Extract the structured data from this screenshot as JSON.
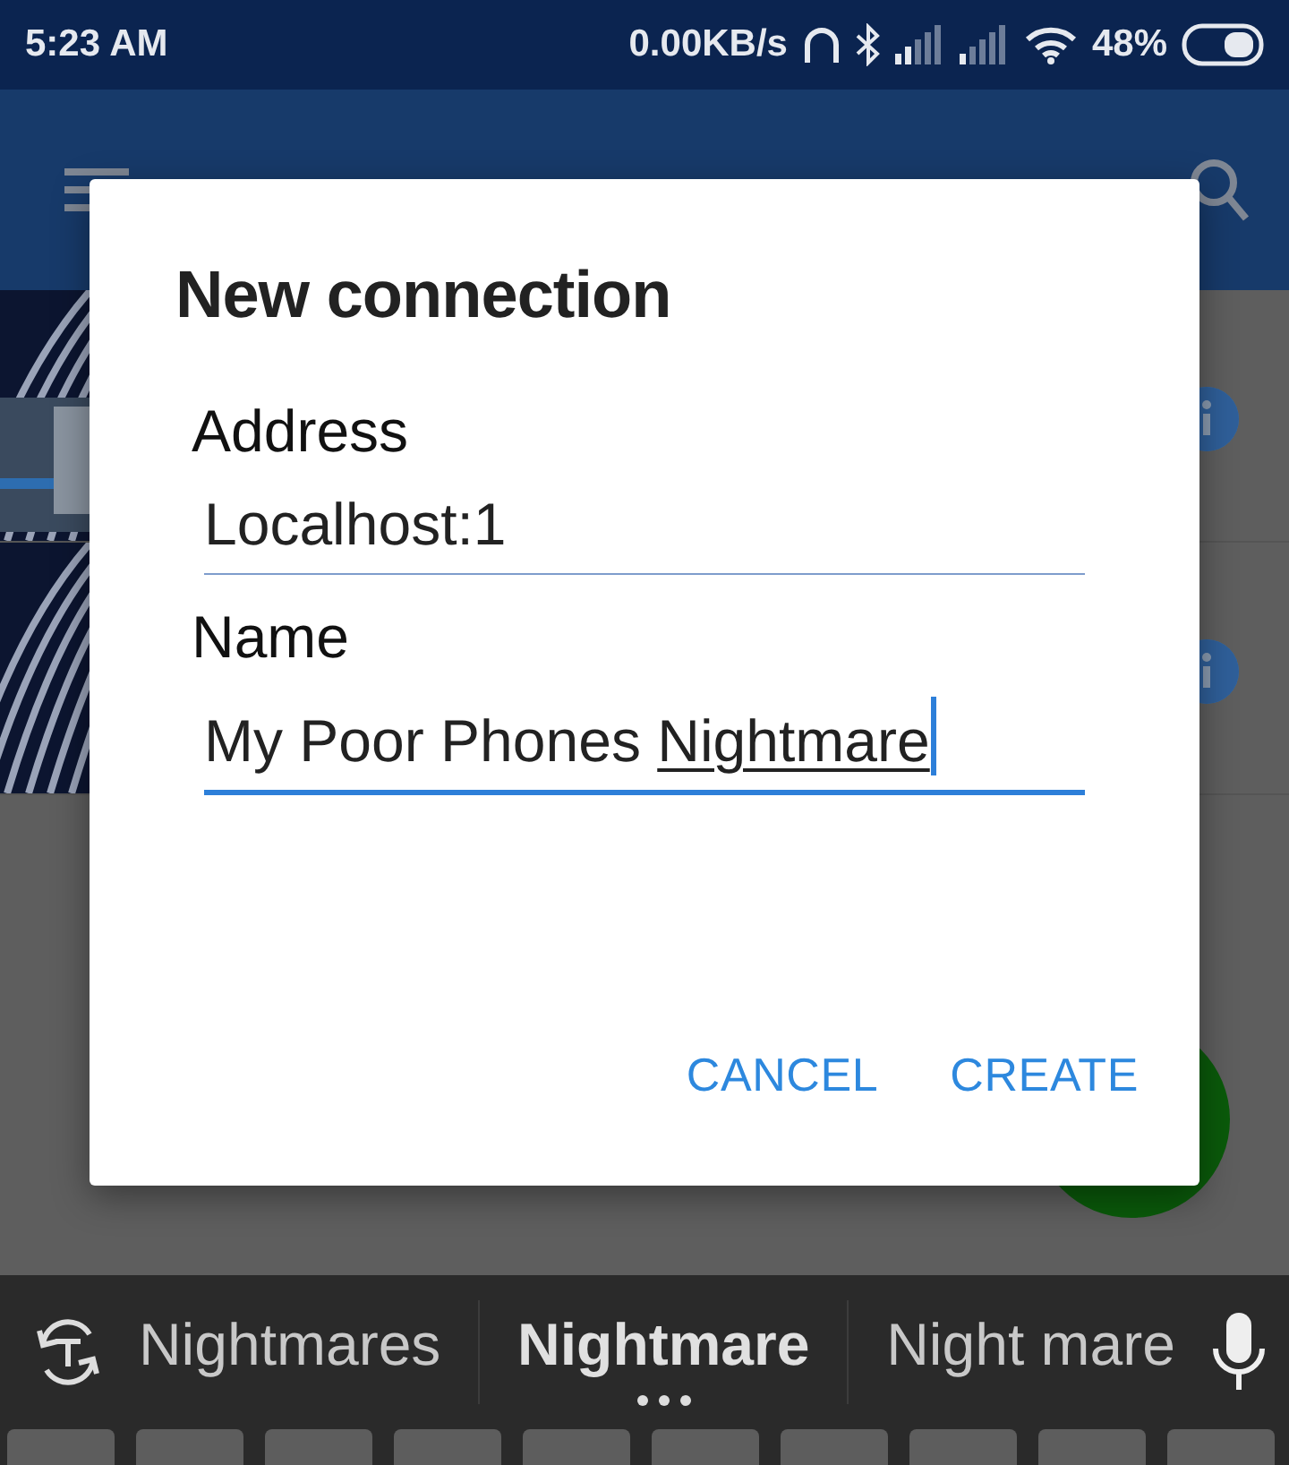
{
  "status_bar": {
    "time": "5:23 AM",
    "speed": "0.00KB/s",
    "battery": "48%"
  },
  "dialog": {
    "title": "New connection",
    "fields": [
      {
        "label": "Address",
        "value": "Localhost:1",
        "focused": false
      },
      {
        "label": "Name",
        "value": "My Poor Phones ",
        "composing": "Nightmare",
        "focused": true
      }
    ],
    "buttons": [
      "CANCEL",
      "CREATE"
    ]
  },
  "keyboard": {
    "suggestions": [
      {
        "text": "Nightmares",
        "selected": false
      },
      {
        "text": "Nightmare",
        "selected": true
      },
      {
        "text": "Night mare",
        "selected": false
      }
    ]
  }
}
